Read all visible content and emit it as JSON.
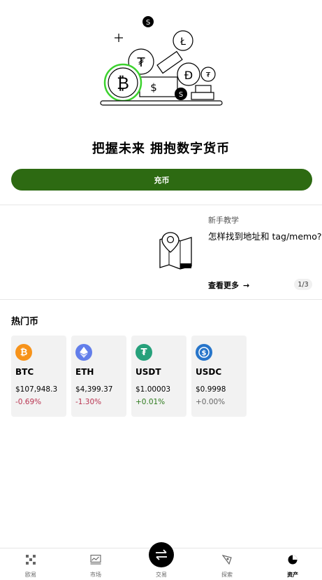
{
  "hero": {
    "headline": "把握未来 拥抱数字货币",
    "deposit_label": "充币"
  },
  "tutorial": {
    "title": "新手教学",
    "question": "怎样找到地址和 tag/memo?",
    "more_label": "查看更多",
    "page": "1/3"
  },
  "hot": {
    "title": "热门币",
    "coins": [
      {
        "symbol": "BTC",
        "price": "$107,948.3",
        "change": "-0.69%",
        "trend": "neg",
        "color": "#f7931a",
        "icon": "bitcoin-icon"
      },
      {
        "symbol": "ETH",
        "price": "$4,399.37",
        "change": "-1.30%",
        "trend": "neg",
        "color": "#627eea",
        "icon": "ethereum-icon"
      },
      {
        "symbol": "USDT",
        "price": "$1.00003",
        "change": "+0.01%",
        "trend": "pos",
        "color": "#26a17b",
        "icon": "tether-icon"
      },
      {
        "symbol": "USDC",
        "price": "$0.9998",
        "change": "+0.00%",
        "trend": "flat",
        "color": "#2775ca",
        "icon": "usdc-icon"
      }
    ]
  },
  "nav": {
    "items": [
      {
        "label": "欧易",
        "icon": "logo-icon"
      },
      {
        "label": "市场",
        "icon": "chart-icon"
      },
      {
        "label": "交易",
        "icon": "swap-icon"
      },
      {
        "label": "探索",
        "icon": "explore-icon"
      },
      {
        "label": "资产",
        "icon": "pie-icon"
      }
    ],
    "active": "资产"
  }
}
